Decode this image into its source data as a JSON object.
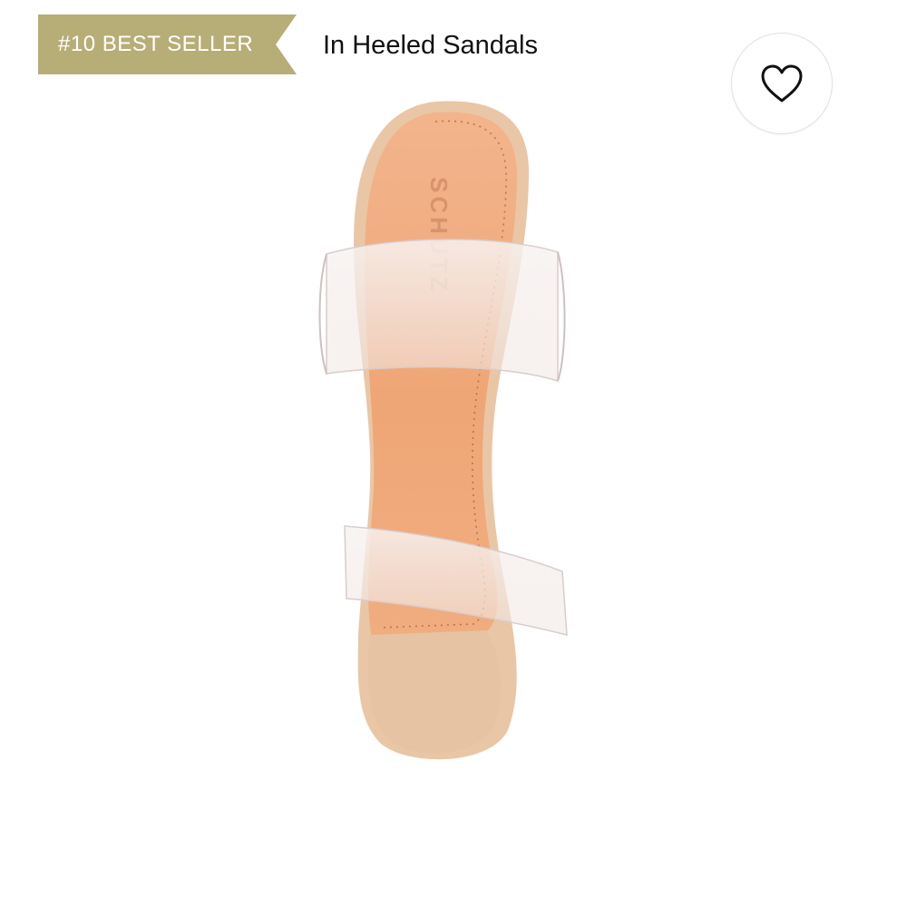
{
  "badge": {
    "label": "#10 BEST SELLER",
    "color": "#b7ad76"
  },
  "category": {
    "label": "In Heeled Sandals"
  },
  "favorite": {
    "icon": "heart-outline-icon"
  },
  "product": {
    "brand_imprint": "SCHUTZ"
  }
}
